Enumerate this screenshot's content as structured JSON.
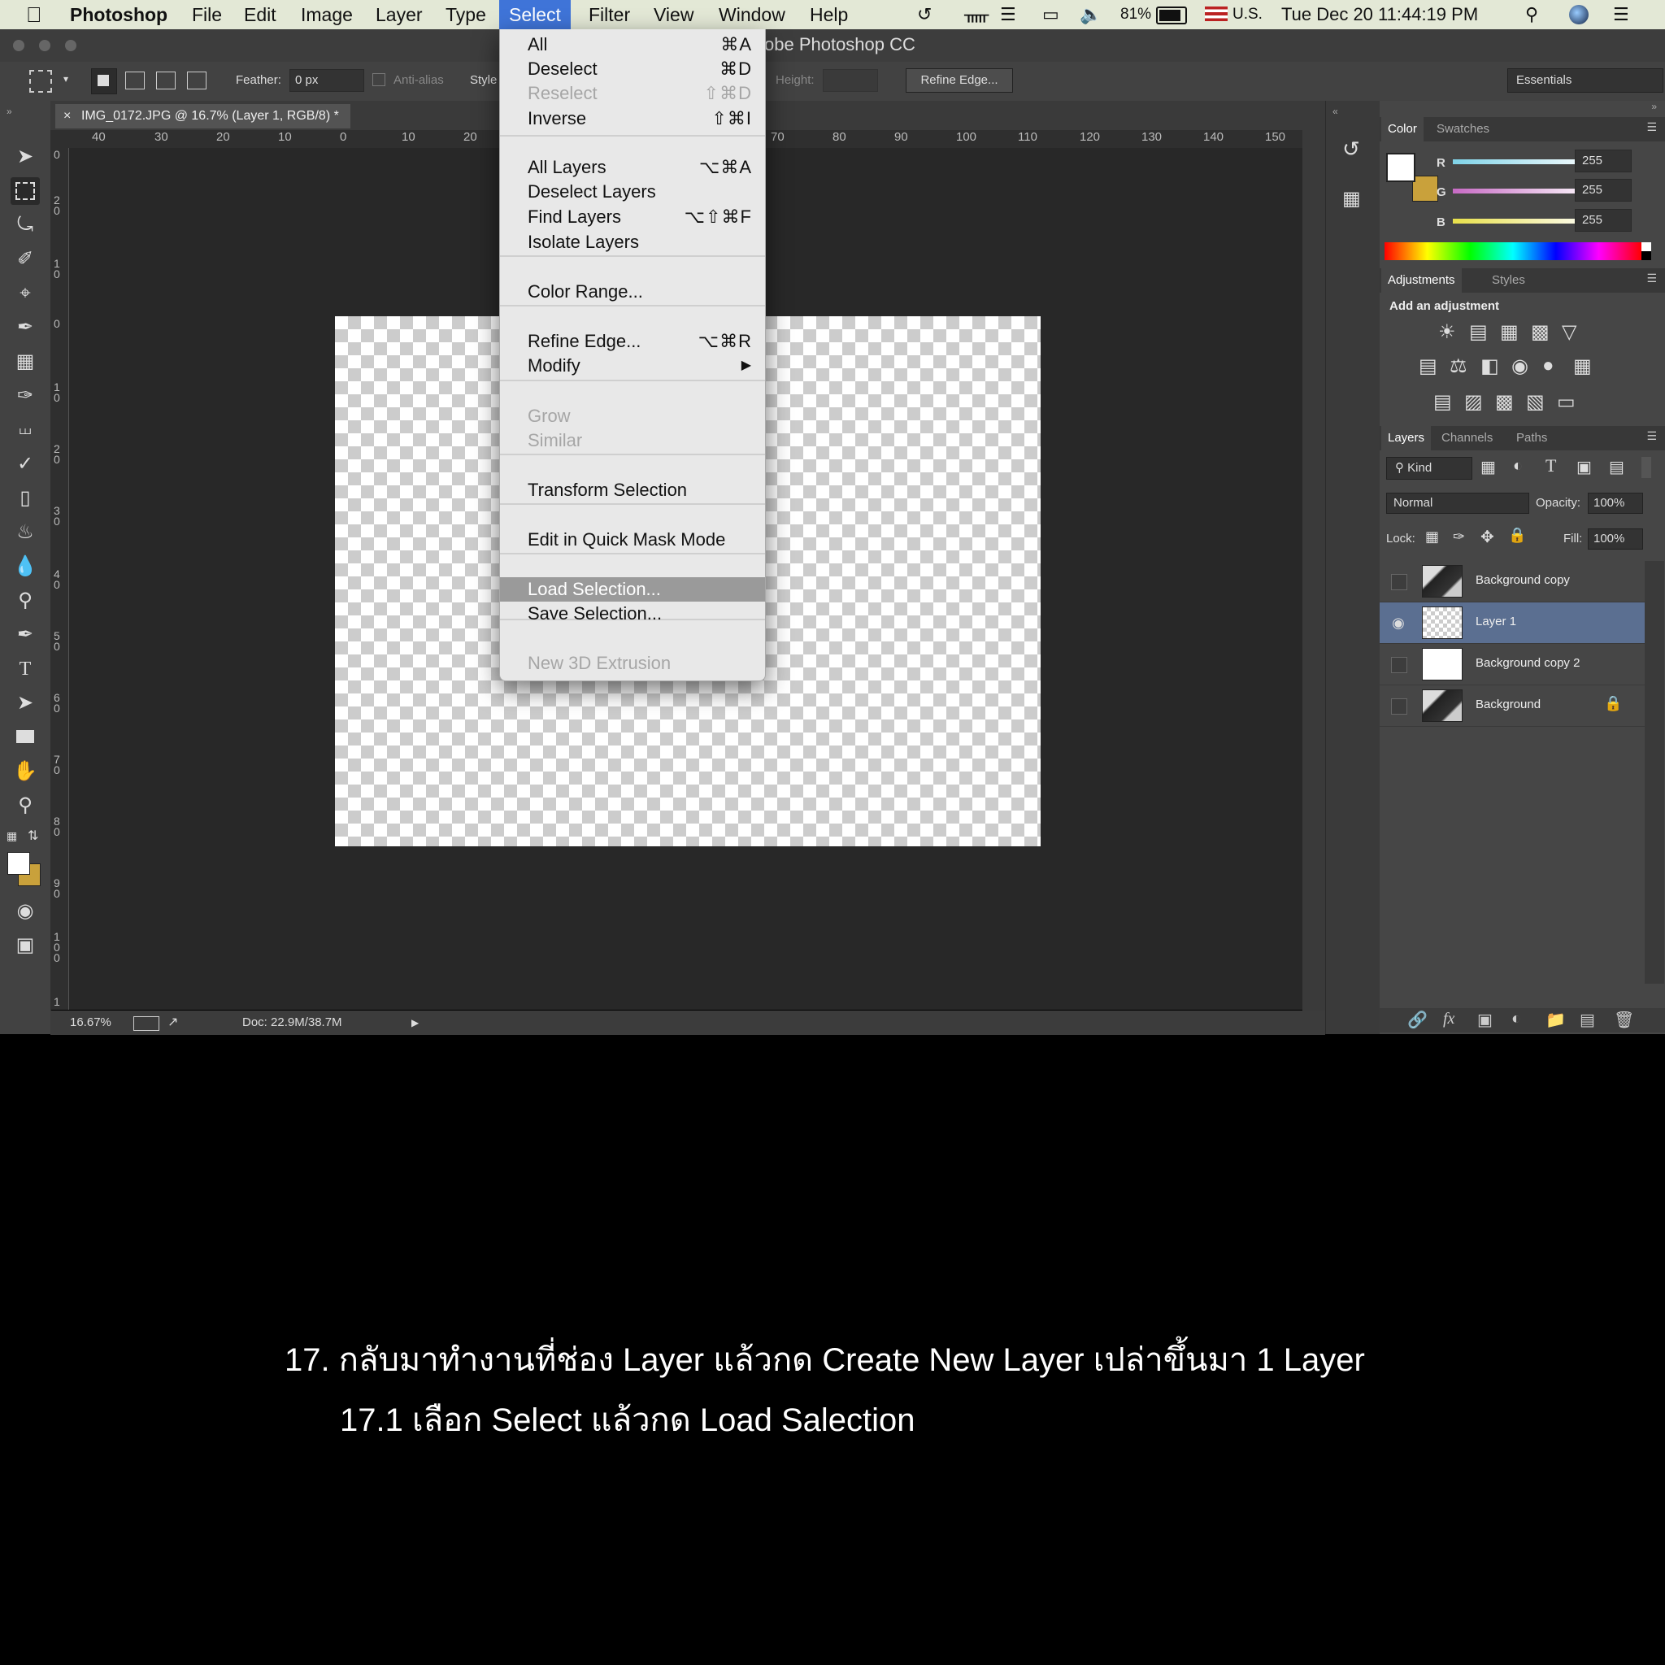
{
  "menubar": {
    "app": "Photoshop",
    "items": [
      "File",
      "Edit",
      "Image",
      "Layer",
      "Type",
      "Select",
      "Filter",
      "View",
      "Window",
      "Help"
    ],
    "battery": "81%",
    "input_source": "U.S.",
    "datetime": "Tue Dec 20  11:44:19 PM"
  },
  "window": {
    "title": "Adobe Photoshop CC",
    "title_visible": "obe Photoshop CC"
  },
  "options": {
    "feather_label": "Feather:",
    "feather_value": "0 px",
    "antialias_label": "Anti-alias",
    "style_label": "Style",
    "height_label": "Height:",
    "refine_button": "Refine Edge...",
    "workspace": "Essentials"
  },
  "document": {
    "tab_title": "IMG_0172.JPG @ 16.7% (Layer 1, RGB/8) *",
    "zoom": "16.67%",
    "doc_size": "Doc: 22.9M/38.7M",
    "hruler_ticks": [
      "40",
      "30",
      "20",
      "10",
      "0",
      "10",
      "20",
      "70",
      "80",
      "90",
      "100",
      "110",
      "120",
      "130",
      "140",
      "150"
    ],
    "vruler_ticks": [
      "0",
      "2 0",
      "1 0",
      "0",
      "1 0",
      "2 0",
      "3 0",
      "4 0",
      "5 0",
      "6 0",
      "7 0",
      "8 0",
      "9 0",
      "1 0 0",
      "1"
    ]
  },
  "select_menu": {
    "items": [
      {
        "label": "All",
        "shortcut": "⌘A",
        "enabled": true
      },
      {
        "label": "Deselect",
        "shortcut": "⌘D",
        "enabled": true
      },
      {
        "label": "Reselect",
        "shortcut": "⇧⌘D",
        "enabled": false
      },
      {
        "label": "Inverse",
        "shortcut": "⇧⌘I",
        "enabled": true
      },
      {
        "label": "All Layers",
        "shortcut": "⌥⌘A",
        "enabled": true
      },
      {
        "label": "Deselect Layers",
        "shortcut": "",
        "enabled": true
      },
      {
        "label": "Find Layers",
        "shortcut": "⌥⇧⌘F",
        "enabled": true
      },
      {
        "label": "Isolate Layers",
        "shortcut": "",
        "enabled": true
      },
      {
        "label": "Color Range...",
        "shortcut": "",
        "enabled": true
      },
      {
        "label": "Refine Edge...",
        "shortcut": "⌥⌘R",
        "enabled": true
      },
      {
        "label": "Modify",
        "shortcut": "▶",
        "enabled": true
      },
      {
        "label": "Grow",
        "shortcut": "",
        "enabled": false
      },
      {
        "label": "Similar",
        "shortcut": "",
        "enabled": false
      },
      {
        "label": "Transform Selection",
        "shortcut": "",
        "enabled": true
      },
      {
        "label": "Edit in Quick Mask Mode",
        "shortcut": "",
        "enabled": true
      },
      {
        "label": "Load Selection...",
        "shortcut": "",
        "enabled": true,
        "highlighted": true
      },
      {
        "label": "Save Selection...",
        "shortcut": "",
        "enabled": true
      },
      {
        "label": "New 3D Extrusion",
        "shortcut": "",
        "enabled": false
      }
    ]
  },
  "color_panel": {
    "tabs": [
      "Color",
      "Swatches"
    ],
    "channels": [
      {
        "label": "R",
        "value": "255",
        "color": "#7fd3e8"
      },
      {
        "label": "G",
        "value": "255",
        "color": "#c76ac4"
      },
      {
        "label": "B",
        "value": "255",
        "color": "#e8e04a"
      }
    ]
  },
  "adjustments_panel": {
    "tabs": [
      "Adjustments",
      "Styles"
    ],
    "heading": "Add an adjustment"
  },
  "layers_panel": {
    "tabs": [
      "Layers",
      "Channels",
      "Paths"
    ],
    "filter": "Kind",
    "blend_mode": "Normal",
    "opacity_label": "Opacity:",
    "opacity": "100%",
    "lock_label": "Lock:",
    "fill_label": "Fill:",
    "fill": "100%",
    "layers": [
      {
        "name": "Background copy",
        "visible": false,
        "selected": false,
        "thumb": "dark"
      },
      {
        "name": "Layer 1",
        "visible": true,
        "selected": true,
        "thumb": "check"
      },
      {
        "name": "Background copy 2",
        "visible": false,
        "selected": false,
        "thumb": "white"
      },
      {
        "name": "Background",
        "visible": false,
        "selected": false,
        "thumb": "dark",
        "locked": true
      }
    ]
  },
  "caption": {
    "line1": "17. กลับมาทำงานที่ช่อง Layer แล้วกด Create New Layer เปล่าขึ้นมา 1 Layer",
    "line2": "17.1 เลือก Select แล้วกด Load Salection"
  },
  "colors": {
    "accent": "#3f74d8",
    "menu_highlight": "#9a9a9a",
    "layer_selected": "#5b6f91",
    "bg_swatch": "#c9a13b"
  }
}
